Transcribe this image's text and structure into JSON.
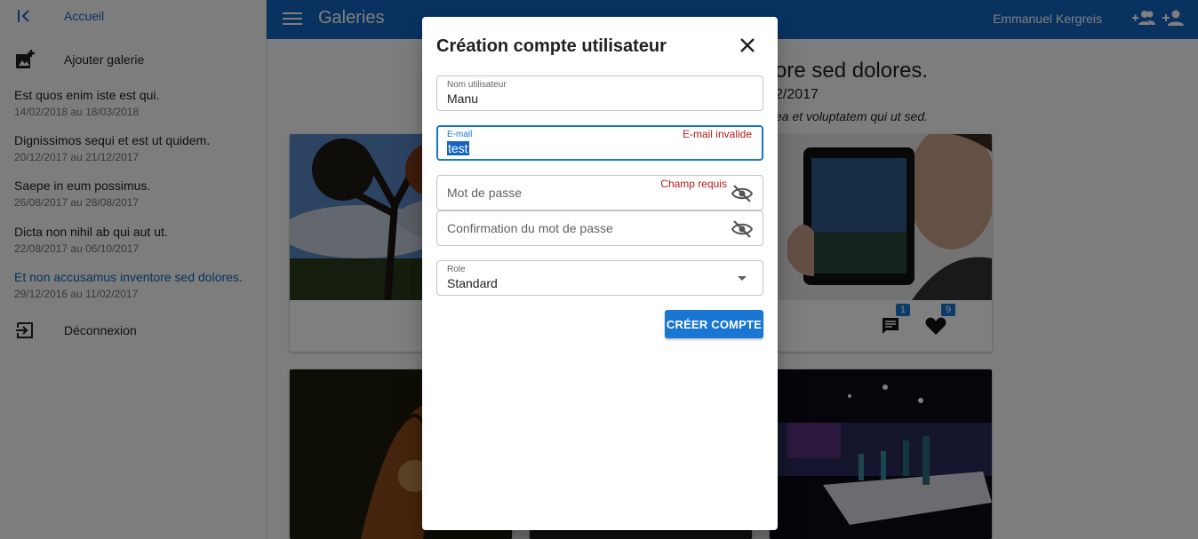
{
  "sidebar": {
    "home_label": "Accueil",
    "add_gallery_label": "Ajouter galerie",
    "logout_label": "Déconnexion",
    "galleries": [
      {
        "title": "Est quos enim iste est qui.",
        "dates": "14/02/2018 au 18/03/2018"
      },
      {
        "title": "Dignissimos sequi et est ut quidem.",
        "dates": "20/12/2017 au 21/12/2017"
      },
      {
        "title": "Saepe in eum possimus.",
        "dates": "26/08/2017 au 28/08/2017"
      },
      {
        "title": "Dicta non nihil ab qui aut ut.",
        "dates": "22/08/2017 au 06/10/2017"
      },
      {
        "title": "Et non accusamus inventore sed dolores.",
        "dates": "29/12/2016 au 11/02/2017"
      }
    ]
  },
  "header": {
    "title": "Galeries",
    "user_name": "Emmanuel Kergreis"
  },
  "main": {
    "gallery_title_visible": "ore sed dolores.",
    "gallery_dates_visible": "2/2017",
    "gallery_desc_visible": "ea et voluptatem qui ut sed.",
    "comments_count": "1",
    "likes_count": "9"
  },
  "dialog": {
    "title": "Création compte utilisateur",
    "username": {
      "label": "Nom utilisateur",
      "value": "Manu"
    },
    "email": {
      "label": "E-mail",
      "value": "test",
      "error": "E-mail invalide"
    },
    "password": {
      "placeholder": "Mot de passe",
      "error": "Champ requis"
    },
    "password_confirm": {
      "placeholder": "Confirmation du mot de passe"
    },
    "role": {
      "label": "Role",
      "value": "Standard"
    },
    "submit_label": "CRÉER COMPTE"
  },
  "colors": {
    "primary": "#1565c0",
    "accent_button": "#1976d2",
    "error": "#b71c1c"
  }
}
